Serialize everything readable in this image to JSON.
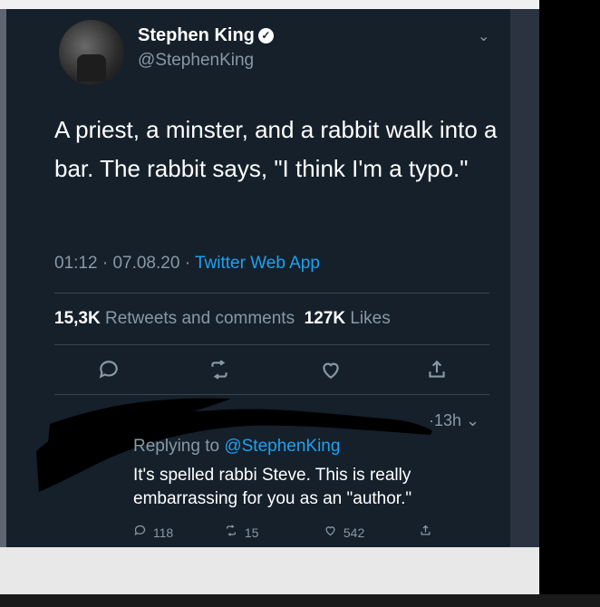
{
  "tweet": {
    "author_name": "Stephen King",
    "verified_glyph": "✓",
    "handle": "@StephenKing",
    "menu_glyph": "⌄",
    "text": "A priest, a minster, and a rabbit walk into a bar. The rabbit says, \"I think I'm a typo.\"",
    "time": "01:12",
    "date": "07.08.20",
    "sep": "·",
    "source": "Twitter Web App",
    "retweets_count": "15,3K",
    "retweets_label": "Retweets and comments",
    "likes_count": "127K",
    "likes_label": "Likes",
    "actions": {
      "reply_icon": "reply-icon",
      "retweet_icon": "retweet-icon",
      "like_icon": "heart-icon",
      "share_icon": "share-icon"
    }
  },
  "reply": {
    "time": "·13h ⌄",
    "replying_prefix": "Replying to",
    "replying_handle": "@StephenKing",
    "text": "It's spelled rabbi Steve. This is really embarrassing for you as an \"author.\"",
    "reply_count": "118",
    "retweet_count": "15",
    "like_count": "542"
  },
  "colors": {
    "background": "#15202b",
    "accent": "#1da1f2",
    "muted": "#8899a6",
    "text": "#ffffff"
  }
}
